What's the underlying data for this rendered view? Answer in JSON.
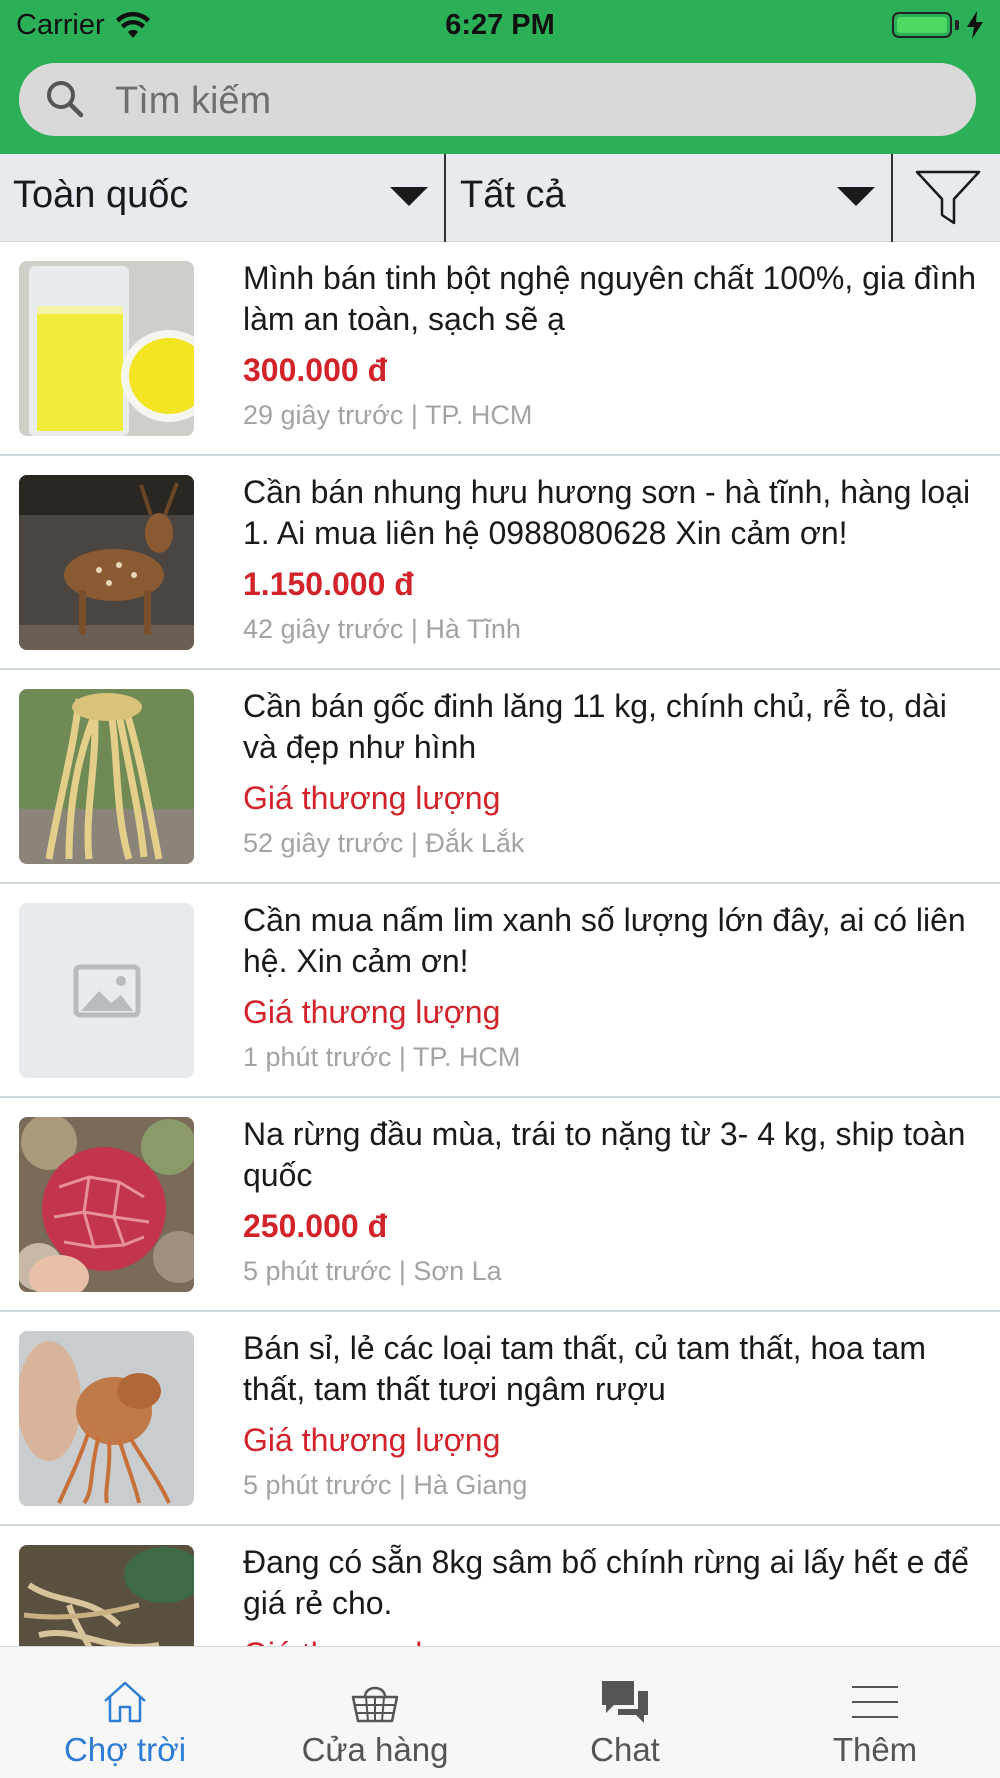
{
  "status_bar": {
    "carrier": "Carrier",
    "time": "6:27 PM"
  },
  "search": {
    "placeholder": "Tìm kiếm"
  },
  "filters": {
    "region": "Toàn quốc",
    "category": "Tất cả"
  },
  "colors": {
    "header": "#2bb058",
    "price": "#d2222a",
    "active_tab": "#2d7cd6"
  },
  "listings": [
    {
      "title": "Mình bán tinh bột nghệ nguyên chất 100%, gia đình làm an toàn, sạch sẽ ạ",
      "price": "300.000 đ",
      "meta": "29 giây trước | TP. HCM",
      "image": "turmeric-powder"
    },
    {
      "title": "Cần bán nhung hưu hương sơn - hà tĩnh, hàng loại 1. Ai mua liên hệ 0988080628 Xin cảm ơn!",
      "price": "1.150.000 đ",
      "meta": "42 giây trước | Hà Tĩnh",
      "image": "deer"
    },
    {
      "title": "Cần bán gốc đinh lăng 11 kg, chính chủ, rễ to, dài và đẹp như hình",
      "price": "Giá thương lượng",
      "meta": "52 giây trước | Đắk Lắk",
      "image": "roots"
    },
    {
      "title": "Cần mua nấm lim xanh số lượng lớn đây, ai có liên hệ. Xin cảm ơn!",
      "price": "Giá thương lượng",
      "meta": "1 phút trước | TP. HCM",
      "image": "placeholder-image-icon"
    },
    {
      "title": "Na rừng đầu mùa, trái to nặng từ 3- 4 kg, ship toàn quốc",
      "price": "250.000 đ",
      "meta": "5 phút trước | Sơn La",
      "image": "forest-fruit"
    },
    {
      "title": "Bán sỉ, lẻ các loại tam thất, củ tam thất, hoa tam thất, tam thất tươi ngâm rượu",
      "price": "Giá thương lượng",
      "meta": "5 phút trước | Hà Giang",
      "image": "tam-that-root"
    },
    {
      "title": "Đang có sẵn 8kg sâm bố chính rừng ai lấy hết e để giá rẻ cho.",
      "price": "Giá thương lượng",
      "meta": "",
      "image": "ginseng"
    }
  ],
  "tabs": [
    {
      "label": "Chợ trời",
      "icon": "home-icon"
    },
    {
      "label": "Cửa hàng",
      "icon": "basket-icon"
    },
    {
      "label": "Chat",
      "icon": "chat-icon"
    },
    {
      "label": "Thêm",
      "icon": "menu-icon"
    }
  ]
}
